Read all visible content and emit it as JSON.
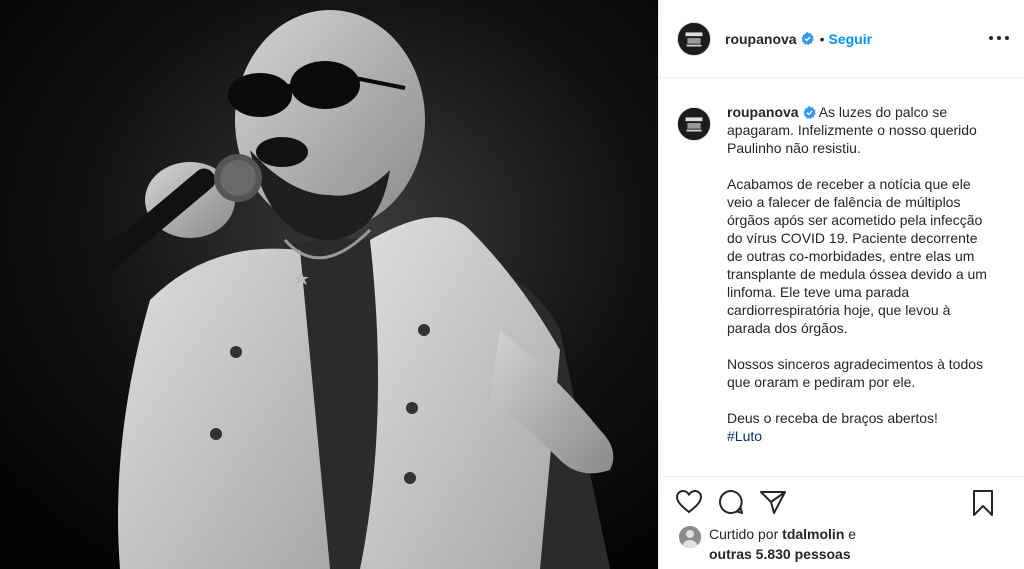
{
  "post": {
    "username": "roupanova",
    "follow_label": "Seguir",
    "separator": "•",
    "caption": {
      "username": "roupanova",
      "paragraph_1": "As luzes do palco se apagaram. Infelizmente o nosso querido Paulinho não resistiu.",
      "paragraph_2": "Acabamos de receber a notícia que ele veio a falecer de falência de múltiplos órgãos após ser acometido pela infecção do vírus COVID 19. Paciente decorrente de outras co-morbidades, entre elas um transplante de medula óssea devido a um linfoma. Ele teve uma parada cardiorrespiratória hoje, que levou à parada dos órgãos.",
      "paragraph_3": "Nossos sinceros agradecimentos à todos que oraram e pediram por ele.",
      "paragraph_4": "Deus o receba de braços abertos!",
      "hashtag": "#Luto"
    },
    "likes": {
      "prefix": "Curtido por",
      "user": "tdalmolin",
      "connector": "e",
      "others": "outras 5.830 pessoas"
    }
  },
  "icons": {
    "verified": "verified-badge-icon",
    "more": "more-options-icon",
    "like": "heart-icon",
    "comment": "comment-icon",
    "share": "share-icon",
    "save": "bookmark-icon"
  },
  "colors": {
    "link_blue": "#0095f6",
    "hashtag_blue": "#00376b",
    "text": "#262626",
    "border": "#efefef"
  }
}
